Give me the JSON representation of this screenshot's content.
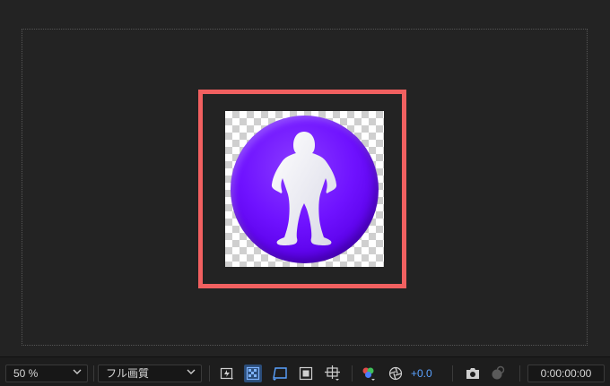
{
  "viewer": {
    "layer_outline_color": "#f16060",
    "badge_color": "#6f12ff"
  },
  "toolbar": {
    "zoom": {
      "value": "50 %"
    },
    "resolution": {
      "value": "フル画質"
    },
    "icons": [
      "fast-previews-icon",
      "transparency-grid-icon",
      "region-of-interest-icon",
      "mask-visibility-icon",
      "guides-grid-icon",
      "color-channels-icon",
      "reset-exposure-icon",
      "snapshot-camera-icon",
      "show-snapshot-icon"
    ],
    "exposure": "+0.0",
    "timecode": "0:00:00:00",
    "accent": "#5aa2ff"
  }
}
